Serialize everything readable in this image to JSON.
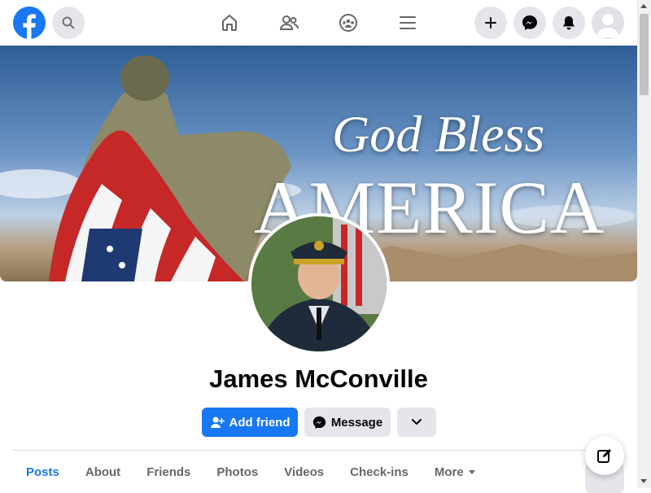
{
  "topbar": {
    "logo_icon": "facebook-logo-icon",
    "search_icon": "search-icon",
    "nav": [
      "home-icon",
      "friends-icon",
      "groups-icon",
      "menu-icon"
    ],
    "right": [
      "plus-icon",
      "messenger-icon",
      "bell-icon",
      "avatar"
    ]
  },
  "cover": {
    "line1": "God Bless",
    "line2": "AMERICA"
  },
  "profile": {
    "name": "James McConville"
  },
  "actions": {
    "add_friend": "Add friend",
    "message": "Message"
  },
  "tabs": [
    {
      "label": "Posts"
    },
    {
      "label": "About"
    },
    {
      "label": "Friends"
    },
    {
      "label": "Photos"
    },
    {
      "label": "Videos"
    },
    {
      "label": "Check-ins"
    },
    {
      "label": "More"
    }
  ],
  "colors": {
    "brand": "#1877f2",
    "button_grey": "#e4e6eb",
    "text_primary": "#050505",
    "text_secondary": "#65676b"
  }
}
